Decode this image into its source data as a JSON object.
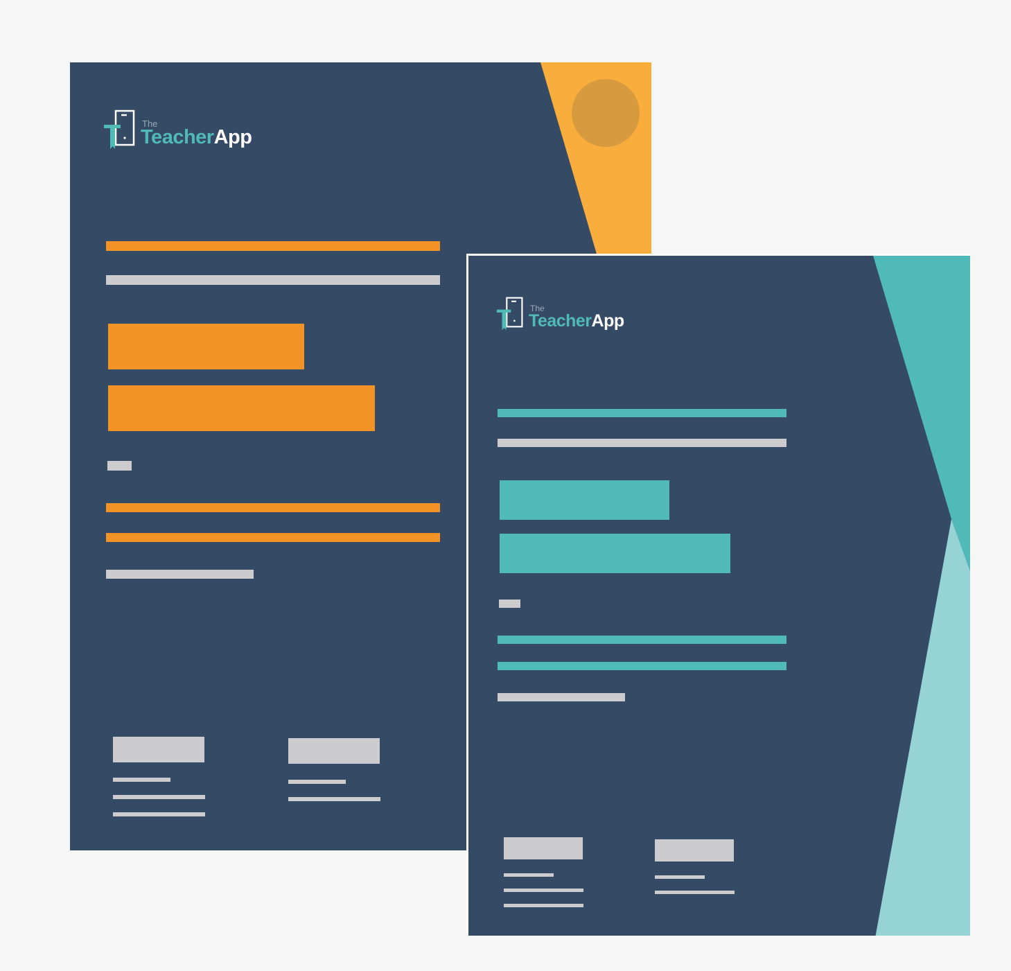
{
  "colors": {
    "background": "#f6f6f6",
    "document": "#354a64",
    "orange_accent": "#f39325",
    "orange_corner": "#f9ad3c",
    "orange_circle": "#d89a3e",
    "teal_accent": "#4fbab7",
    "teal_light": "#96d3d4",
    "placeholder_gray": "#cccbce",
    "white": "#ffffff"
  },
  "documents": [
    {
      "id": "back",
      "theme": "orange",
      "logo": {
        "the": "The",
        "teacher": "Teacher",
        "app": "App",
        "icon": "phone-t-logo-icon"
      }
    },
    {
      "id": "front",
      "theme": "teal",
      "logo": {
        "the": "The",
        "teacher": "Teacher",
        "app": "App",
        "icon": "phone-t-logo-icon"
      }
    }
  ]
}
